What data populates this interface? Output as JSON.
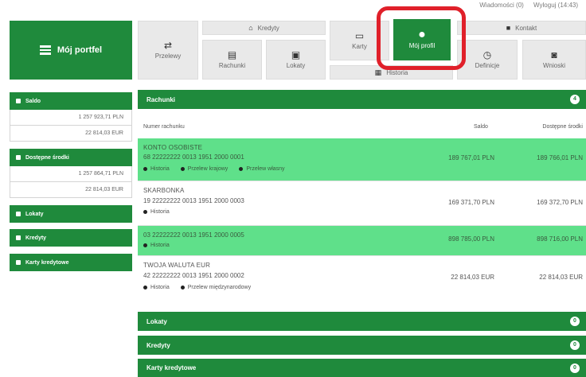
{
  "top_links": {
    "messages": "Wiadomości (0)",
    "logout": "Wyloguj (14:43)"
  },
  "sidebar": {
    "portfolio_label": "Mój portfel",
    "sections": [
      {
        "title": "Saldo",
        "values": [
          "1 257 923,71 PLN",
          "22 814,03 EUR"
        ]
      },
      {
        "title": "Dostępne środki",
        "values": [
          "1 257 864,71 PLN",
          "22 814,03 EUR"
        ]
      },
      {
        "title": "Lokaty",
        "values": []
      },
      {
        "title": "Kredyty",
        "values": []
      },
      {
        "title": "Karty kredytowe",
        "values": []
      }
    ]
  },
  "nav": {
    "przelewy": "Przelewy",
    "kredyty": "Kredyty",
    "rachunki": "Rachunki",
    "lokaty": "Lokaty",
    "karty": "Karty",
    "moj_profil": "Mój profil",
    "kontakt": "Kontakt",
    "historia": "Historia",
    "definicje": "Definicje",
    "wnioski": "Wnioski"
  },
  "accounts_panel": {
    "title": "Rachunki",
    "count": "4",
    "col_number": "Numer rachunku",
    "col_balance": "Saldo",
    "col_available": "Dostępne środki",
    "rows": [
      {
        "name": "KONTO OSOBISTE",
        "number": "68 22222222 0013 1951 2000 0001",
        "links": [
          "Historia",
          "Przelew krajowy",
          "Przelew własny"
        ],
        "balance": "189 767,01 PLN",
        "available": "189 766,01 PLN",
        "highlighted": true
      },
      {
        "name": "SKARBONKA",
        "number": "19 22222222 0013 1951 2000 0003",
        "links": [
          "Historia"
        ],
        "balance": "169 371,70 PLN",
        "available": "169 372,70 PLN",
        "highlighted": false
      },
      {
        "name": "",
        "number": "03 22222222 0013 1951 2000 0005",
        "links": [
          "Historia"
        ],
        "balance": "898 785,00 PLN",
        "available": "898 716,00 PLN",
        "highlighted": true
      },
      {
        "name": "TWOJA WALUTA EUR",
        "number": "42 22222222 0013 1951 2000 0002",
        "links": [
          "Historia",
          "Przelew międzynarodowy"
        ],
        "balance": "22 814,03 EUR",
        "available": "22 814,03 EUR",
        "highlighted": false
      }
    ]
  },
  "collapsed_panels": [
    {
      "title": "Lokaty",
      "count": "0"
    },
    {
      "title": "Kredyty",
      "count": "0"
    },
    {
      "title": "Karty kredytowe",
      "count": "0"
    }
  ],
  "colors": {
    "brand_green": "#1f8a3c",
    "row_highlight": "#5fe08a",
    "callout_red": "#e0202a"
  }
}
